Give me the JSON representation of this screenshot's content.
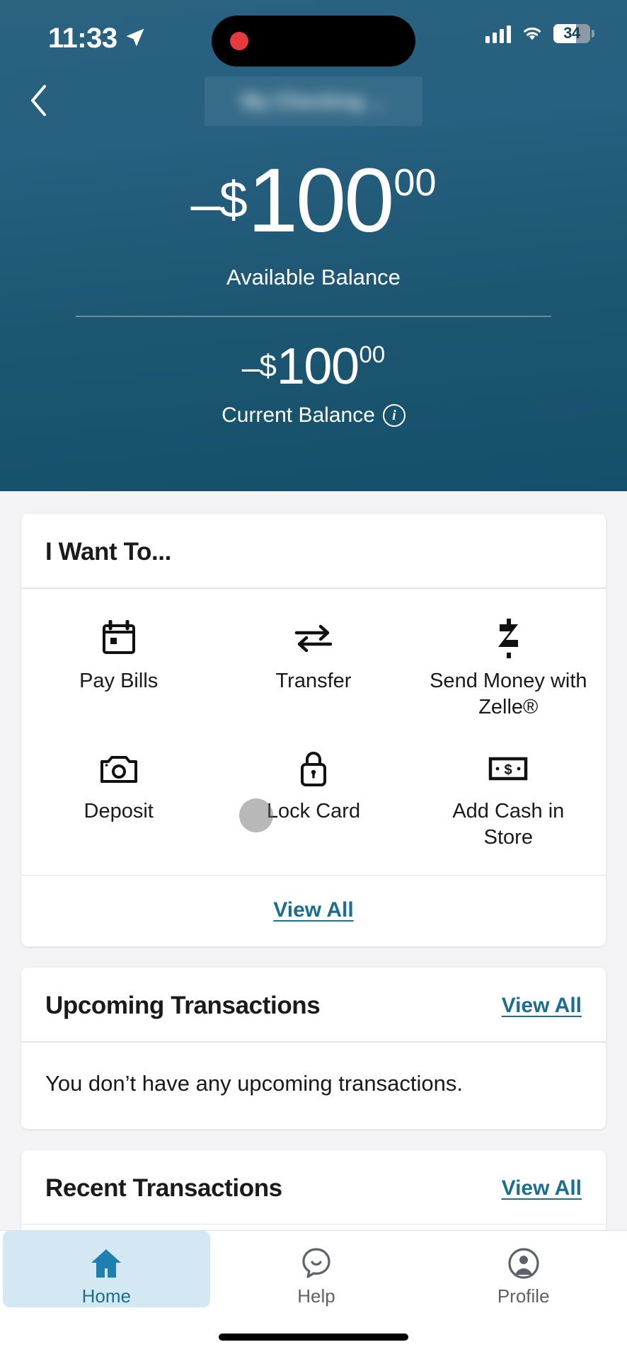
{
  "status_bar": {
    "time": "11:33",
    "location_icon": "location-arrow-icon",
    "recording_indicator": "recording-dot",
    "cellular_icon": "cellular-bars-icon",
    "wifi_icon": "wifi-icon",
    "battery_percent": "34"
  },
  "header": {
    "back_label": "back-chevron-icon",
    "account_title_redacted": "My Checking ...",
    "available": {
      "sign": "–",
      "currency": "$",
      "amount": "100",
      "cents": "00",
      "label": "Available Balance"
    },
    "current": {
      "sign": "–",
      "currency": "$",
      "amount": "100",
      "cents": "00",
      "label": "Current Balance",
      "info_glyph": "i"
    }
  },
  "i_want_to": {
    "title": "I Want To...",
    "actions": [
      {
        "label": "Pay\nBills",
        "icon": "calendar-icon"
      },
      {
        "label": "Transfer",
        "icon": "transfer-arrows-icon"
      },
      {
        "label": "Send Money\nwith Zelle®",
        "icon": "zelle-icon"
      },
      {
        "label": "Deposit",
        "icon": "camera-icon"
      },
      {
        "label": "Lock\nCard",
        "icon": "lock-icon"
      },
      {
        "label": "Add Cash\nin Store",
        "icon": "banknote-icon"
      }
    ],
    "view_all_label": "View All"
  },
  "upcoming": {
    "title": "Upcoming Transactions",
    "view_all_label": "View All",
    "empty_message": "You don’t have any upcoming transactions."
  },
  "recent": {
    "title": "Recent Transactions",
    "view_all_label": "View All"
  },
  "tabbar": {
    "tabs": [
      {
        "label": "Home",
        "icon": "home-icon",
        "active": true
      },
      {
        "label": "Help",
        "icon": "chat-smile-icon",
        "active": false
      },
      {
        "label": "Profile",
        "icon": "person-circle-icon",
        "active": false
      }
    ]
  },
  "colors": {
    "header_blue": "#1d5671",
    "link_teal": "#1a6f8f",
    "active_tab_bg": "#d4e8f3",
    "page_bg": "#f4f4f6"
  }
}
